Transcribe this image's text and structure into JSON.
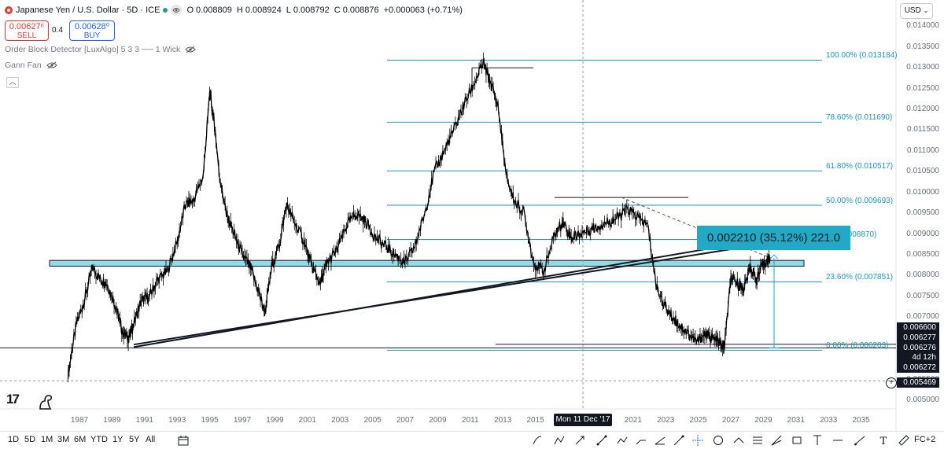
{
  "symbol": {
    "title": "Japanese Yen / U.S. Dollar · 5D · ICE",
    "ohlc": [
      {
        "label": "O",
        "value": "0.008809"
      },
      {
        "label": "H",
        "value": "0.008924"
      },
      {
        "label": "L",
        "value": "0.008792"
      },
      {
        "label": "C",
        "value": "0.008876"
      }
    ],
    "change": "+0.000063 (+0.71%)"
  },
  "trade": {
    "sell_price": "0.00627⁶",
    "sell_label": "SELL",
    "spread": "0.4",
    "buy_price": "0.00628⁰",
    "buy_label": "BUY"
  },
  "indicators": [
    {
      "name": "Order Block Detector [LuxAlgo] 5 3 3 ── 1 Wick"
    },
    {
      "name": "Gann Fan"
    }
  ],
  "currency_button": "USD",
  "y_axis": {
    "min": 0.005,
    "max": 0.0145,
    "ticks": [
      "0.014000",
      "0.013500",
      "0.013000",
      "0.012500",
      "0.012000",
      "0.011500",
      "0.011000",
      "0.010500",
      "0.010000",
      "0.009500",
      "0.009000",
      "0.008500",
      "0.008000",
      "0.007500",
      "0.007000",
      "0.006500",
      "0.006000",
      "0.005500",
      "0.005000"
    ],
    "tick_values": [
      0.014,
      0.0135,
      0.013,
      0.0125,
      0.012,
      0.0115,
      0.011,
      0.0105,
      0.01,
      0.0095,
      0.009,
      0.0085,
      0.008,
      0.0075,
      0.007,
      0.0065,
      0.006,
      0.0055,
      0.005
    ]
  },
  "x_axis": {
    "ticks": [
      "1987",
      "1989",
      "1991",
      "1993",
      "1995",
      "1997",
      "1999",
      "2001",
      "2003",
      "2005",
      "2007",
      "2009",
      "2011",
      "2013",
      "2015",
      "2017",
      "2019",
      "2021",
      "2023",
      "2025",
      "2027",
      "2029",
      "2031",
      "2033",
      "2035"
    ],
    "crosshair_label": "Mon 11 Dec '17"
  },
  "price_tags": [
    {
      "text": "0.006600",
      "value": 0.0066,
      "style": "dark"
    },
    {
      "text": "0.006277",
      "value": 0.006277,
      "style": "dark"
    },
    {
      "text": "0.006276",
      "value": 0.006276,
      "style": "dark"
    },
    {
      "text": "4d 12h",
      "value": 0.00618,
      "style": "dark"
    },
    {
      "text": "0.006272",
      "value": 0.006078,
      "style": "dark"
    },
    {
      "text": "0.005469",
      "value": 0.005469,
      "style": "dark"
    }
  ],
  "fibonacci": [
    {
      "label": "100.00% (0.013184)",
      "value": 0.013184
    },
    {
      "label": "78.60% (0.011690)",
      "value": 0.01169
    },
    {
      "label": "61.80% (0.010517)",
      "value": 0.010517
    },
    {
      "label": "50.00% (0.009693)",
      "value": 0.009693
    },
    {
      "label": "(0.008870)",
      "value": 0.00887
    },
    {
      "label": "23.60% (0.007851)",
      "value": 0.007851
    },
    {
      "label": "0.00% (0.006203)",
      "value": 0.006203
    }
  ],
  "measure_label": "0.002210 (35.12%) 221.0",
  "timeframes": [
    "1D",
    "5D",
    "1M",
    "3M",
    "6M",
    "YTD",
    "1Y",
    "5Y",
    "All"
  ],
  "bottom_right": "FC+2",
  "colors": {
    "fib": "#1d98b4",
    "zone": "#5fc9dc",
    "measure": "#22a9c6",
    "candle": "#000000"
  },
  "chart_data": {
    "type": "line",
    "title": "Japanese Yen / U.S. Dollar",
    "xlabel": "",
    "ylabel": "",
    "ylim": [
      0.005,
      0.0145
    ],
    "xlim": [
      1985.5,
      2037.5
    ],
    "grid": false,
    "series": [
      {
        "name": "Japanese Yen / U.S. Dollar",
        "x": [
          1986.3,
          1986.8,
          1987.3,
          1987.8,
          1988.3,
          1988.7,
          1989.2,
          1989.6,
          1990.0,
          1990.3,
          1990.8,
          1991.3,
          1991.8,
          1992.4,
          1993.0,
          1993.5,
          1994.0,
          1994.6,
          1995.0,
          1995.3,
          1995.6,
          1996.0,
          1996.5,
          1997.0,
          1997.5,
          1998.0,
          1998.4,
          1998.8,
          1999.3,
          1999.7,
          2000.2,
          2000.8,
          2001.3,
          2001.8,
          2002.2,
          2002.8,
          2003.4,
          2004.0,
          2004.6,
          2005.2,
          2005.8,
          2006.4,
          2007.0,
          2007.6,
          2008.2,
          2008.8,
          2009.4,
          2010.0,
          2010.6,
          2011.2,
          2011.8,
          2012.2,
          2012.7,
          2013.2,
          2013.7,
          2014.3,
          2014.9,
          2015.5,
          2016.2,
          2016.7,
          2017.2,
          2017.7,
          2018.3,
          2018.9,
          2019.5,
          2020.1,
          2020.7,
          2021.3,
          2021.9,
          2022.4,
          2022.9,
          2023.4,
          2023.9,
          2024.4,
          2024.9,
          2025.4,
          2025.8,
          2026.2,
          2026.6,
          2027.0,
          2027.4,
          2027.8,
          2028.2,
          2028.6,
          2029.0,
          2029.4
        ],
        "y": [
          0.00565,
          0.0068,
          0.0074,
          0.0082,
          0.0079,
          0.0078,
          0.0073,
          0.0067,
          0.0065,
          0.0068,
          0.0074,
          0.0075,
          0.0079,
          0.0081,
          0.0088,
          0.0097,
          0.0098,
          0.0104,
          0.0124,
          0.0116,
          0.0104,
          0.0095,
          0.009,
          0.0085,
          0.0082,
          0.0076,
          0.0071,
          0.0082,
          0.0088,
          0.0097,
          0.0093,
          0.0088,
          0.0082,
          0.0078,
          0.0083,
          0.0086,
          0.0092,
          0.0095,
          0.0093,
          0.0089,
          0.0087,
          0.0085,
          0.0083,
          0.0087,
          0.0095,
          0.0105,
          0.011,
          0.0115,
          0.0121,
          0.0126,
          0.0131,
          0.0127,
          0.0121,
          0.0104,
          0.0098,
          0.0095,
          0.0083,
          0.0081,
          0.009,
          0.0093,
          0.0089,
          0.009,
          0.0091,
          0.0092,
          0.0093,
          0.0094,
          0.0096,
          0.0094,
          0.0092,
          0.0078,
          0.0073,
          0.007,
          0.0068,
          0.0066,
          0.0064,
          0.0066,
          0.0065,
          0.0064,
          0.0063,
          0.0079,
          0.0078,
          0.0077,
          0.0082,
          0.0079,
          0.0083,
          0.0084
        ]
      }
    ]
  }
}
